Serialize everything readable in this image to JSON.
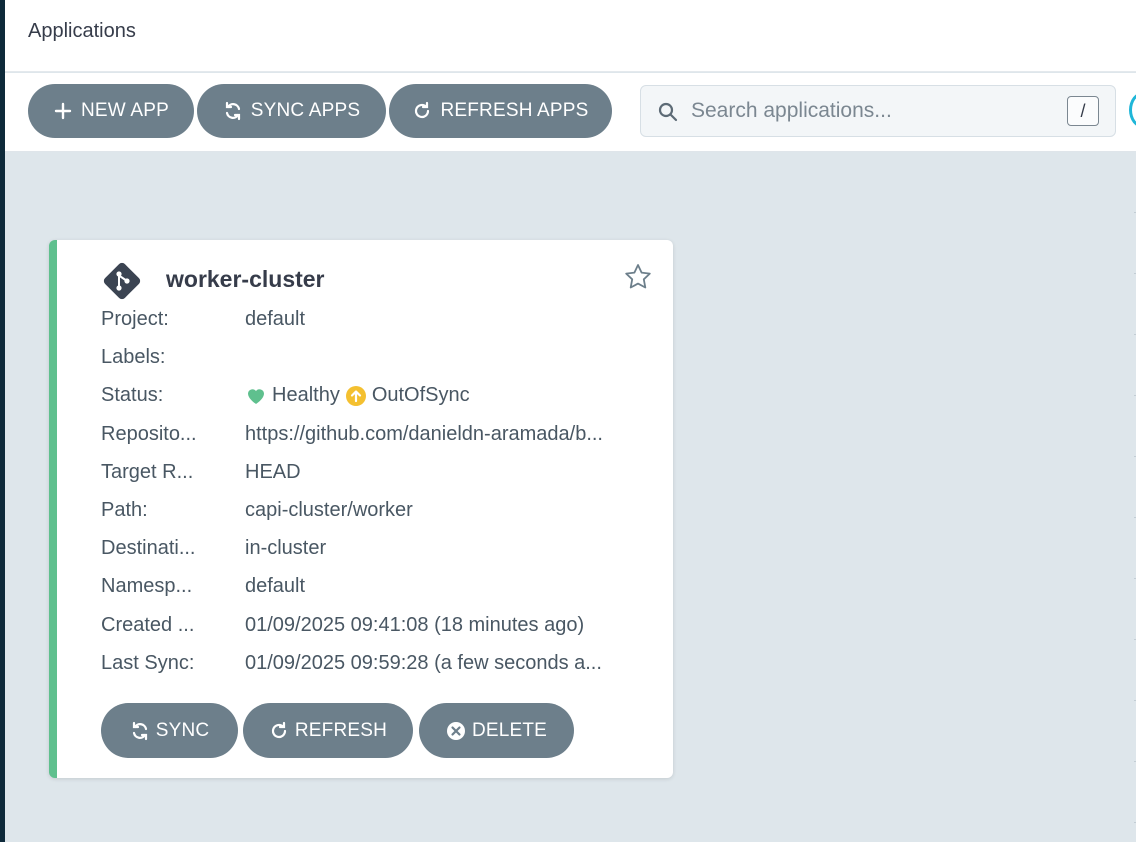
{
  "header": {
    "title": "Applications"
  },
  "toolbar": {
    "new_app": "NEW APP",
    "sync_apps": "SYNC APPS",
    "refresh_apps": "REFRESH APPS"
  },
  "search": {
    "placeholder": "Search applications...",
    "shortcut": "/"
  },
  "app": {
    "name": "worker-cluster",
    "fields": [
      {
        "label": "Project:",
        "value": "default"
      },
      {
        "label": "Labels:",
        "value": ""
      },
      {
        "label": "Status:",
        "health": "Healthy",
        "sync": "OutOfSync"
      },
      {
        "label": "Reposito...",
        "value": "https://github.com/danieldn-aramada/b..."
      },
      {
        "label": "Target R...",
        "value": "HEAD"
      },
      {
        "label": "Path:",
        "value": "capi-cluster/worker"
      },
      {
        "label": "Destinati...",
        "value": "in-cluster"
      },
      {
        "label": "Namesp...",
        "value": "default"
      },
      {
        "label": "Created ...",
        "value": "01/09/2025 09:41:08  (18 minutes ago)"
      },
      {
        "label": "Last Sync:",
        "value": "01/09/2025 09:59:28  (a few seconds a..."
      }
    ],
    "actions": {
      "sync": "SYNC",
      "refresh": "REFRESH",
      "delete": "DELETE"
    }
  },
  "colors": {
    "button": "#6d7f8b",
    "healthy": "#5fc08e",
    "out_of_sync": "#f4c030",
    "page_bg": "#dee6eb"
  }
}
